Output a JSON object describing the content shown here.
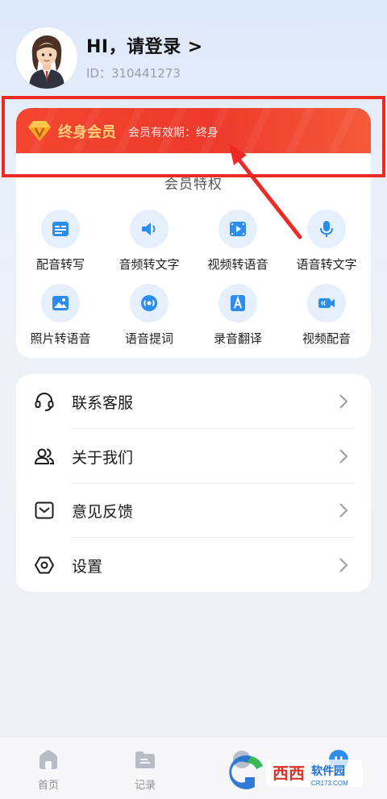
{
  "header": {
    "login_title": "HI，请登录 >",
    "user_id": "ID：310441273"
  },
  "member": {
    "vip_title": "终身会员",
    "vip_validity": "会员有效期：终身",
    "privileges_title": "会员特权",
    "features": [
      {
        "label": "配音转写",
        "icon": "text-card-icon"
      },
      {
        "label": "音频转文字",
        "icon": "speaker-icon"
      },
      {
        "label": "视频转语音",
        "icon": "video-play-icon"
      },
      {
        "label": "语音转文字",
        "icon": "microphone-icon"
      },
      {
        "label": "照片转语音",
        "icon": "photo-icon"
      },
      {
        "label": "语音提词",
        "icon": "audio-wave-icon"
      },
      {
        "label": "录音翻译",
        "icon": "translate-icon"
      },
      {
        "label": "视频配音",
        "icon": "video-camera-icon"
      }
    ]
  },
  "menu": {
    "items": [
      {
        "label": "联系客服",
        "icon": "headset-icon"
      },
      {
        "label": "关于我们",
        "icon": "users-icon"
      },
      {
        "label": "意见反馈",
        "icon": "feedback-mail-icon"
      },
      {
        "label": "设置",
        "icon": "settings-hexagon-icon"
      }
    ]
  },
  "bottom_nav": {
    "items": [
      {
        "label": "首页",
        "icon": "home-icon"
      },
      {
        "label": "记录",
        "icon": "folder-icon"
      }
    ]
  },
  "watermark": {
    "text": "西西软件园",
    "sub": "CR173.COM"
  },
  "colors": {
    "accent_blue": "#2d8cf0",
    "vip_red": "#ee3a2c",
    "vip_gold": "#ffd27a",
    "annotation_red": "#ee2a24"
  }
}
